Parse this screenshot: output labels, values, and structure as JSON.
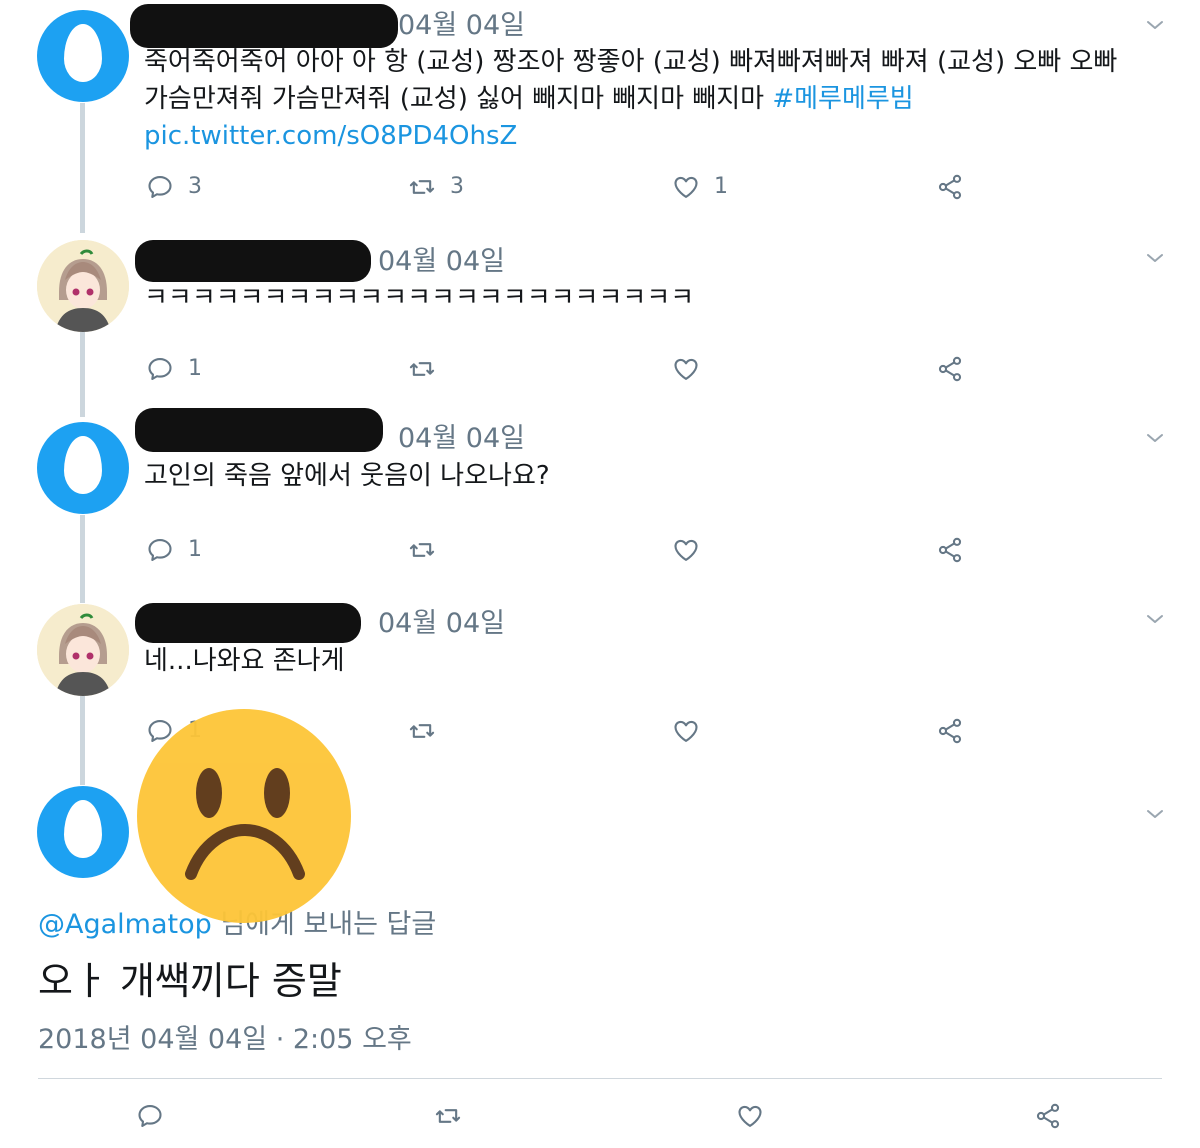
{
  "tweets": [
    {
      "date": "04월 04일",
      "text": "죽어죽어죽어 아아 아 항 (교성) 짱조아 짱좋아 (교성) 빠져빠져빠져 빠져 (교성) 오빠 오빠 가슴만져줘 가슴만져줘 (교성) 싫어 빼지마 빼지마 빼지마 ",
      "hashtag": "#메루메루빔",
      "link": "pic.twitter.com/sO8PD4OhsZ",
      "reply_count": "3",
      "retweet_count": "3",
      "like_count": "1"
    },
    {
      "date": "04월 04일",
      "text": "ㅋㅋㅋㅋㅋㅋㅋㅋㅋㅋㅋㅋㅋㅋㅋㅋㅋㅋㅋㅋㅋㅋㅋ",
      "reply_count": "1"
    },
    {
      "date": "04월 04일",
      "text": "고인의 죽음 앞에서 웃음이 나오나요?",
      "reply_count": "1"
    },
    {
      "date": "04월 04일",
      "text": "네...나와요 존나게",
      "reply_count": "1"
    }
  ],
  "main_tweet": {
    "reply_to_mention": "@Agalmatop",
    "reply_to_suffix": " 님에게 보내는 답글",
    "text": "오ㅏ 개쌕끼다 증말",
    "timestamp": "2018년 04월 04일 · 2:05 오후"
  },
  "colors": {
    "accent": "#1da1f2",
    "link": "#1b95e0",
    "secondary_text": "#657786",
    "emoji_yellow": "#fdc537"
  },
  "icons": [
    "reply-icon",
    "retweet-icon",
    "like-icon",
    "share-icon",
    "chevron-down-icon",
    "egg-avatar-icon",
    "frowning-face-emoji"
  ]
}
